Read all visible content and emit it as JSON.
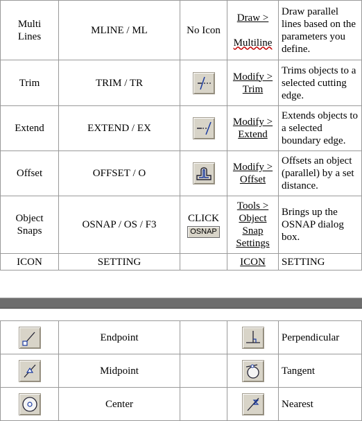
{
  "commands": [
    {
      "name": "Multi Lines",
      "shortcut": "MLINE / ML",
      "icon_text": "No Icon",
      "menu": [
        "Draw >",
        "Multiline"
      ],
      "description": "Draw parallel lines based on the parameters you define."
    },
    {
      "name": "Trim",
      "shortcut": "TRIM / TR",
      "icon": "trim-icon",
      "menu": [
        "Modify >",
        "Trim"
      ],
      "description": "Trims objects to a selected cutting edge."
    },
    {
      "name": "Extend",
      "shortcut": "EXTEND / EX",
      "icon": "extend-icon",
      "menu": [
        "Modify >",
        "Extend"
      ],
      "description": "Extends objects to a selected boundary edge."
    },
    {
      "name": "Offset",
      "shortcut": "OFFSET / O",
      "icon": "offset-icon",
      "menu": [
        "Modify >",
        "Offset"
      ],
      "description": "Offsets an object (parallel) by a set distance."
    },
    {
      "name": "Object Snaps",
      "shortcut": "OSNAP / OS / F3",
      "icon_text": "CLICK",
      "button_label": "OSNAP",
      "menu": [
        "Tools >",
        "Object Snap Settings"
      ],
      "description": "Brings up the OSNAP dialog box."
    }
  ],
  "footer_row": {
    "col1": "ICON",
    "col2": "SETTING",
    "col4": "ICON",
    "col5": "SETTING"
  },
  "snaps": [
    {
      "left_icon": "endpoint-icon",
      "left_label": "Endpoint",
      "right_icon": "perpendicular-icon",
      "right_label": "Perpendicular"
    },
    {
      "left_icon": "midpoint-icon",
      "left_label": "Midpoint",
      "right_icon": "tangent-icon",
      "right_label": "Tangent"
    },
    {
      "left_icon": "center-icon",
      "left_label": "Center",
      "right_icon": "nearest-icon",
      "right_label": "Nearest"
    }
  ]
}
